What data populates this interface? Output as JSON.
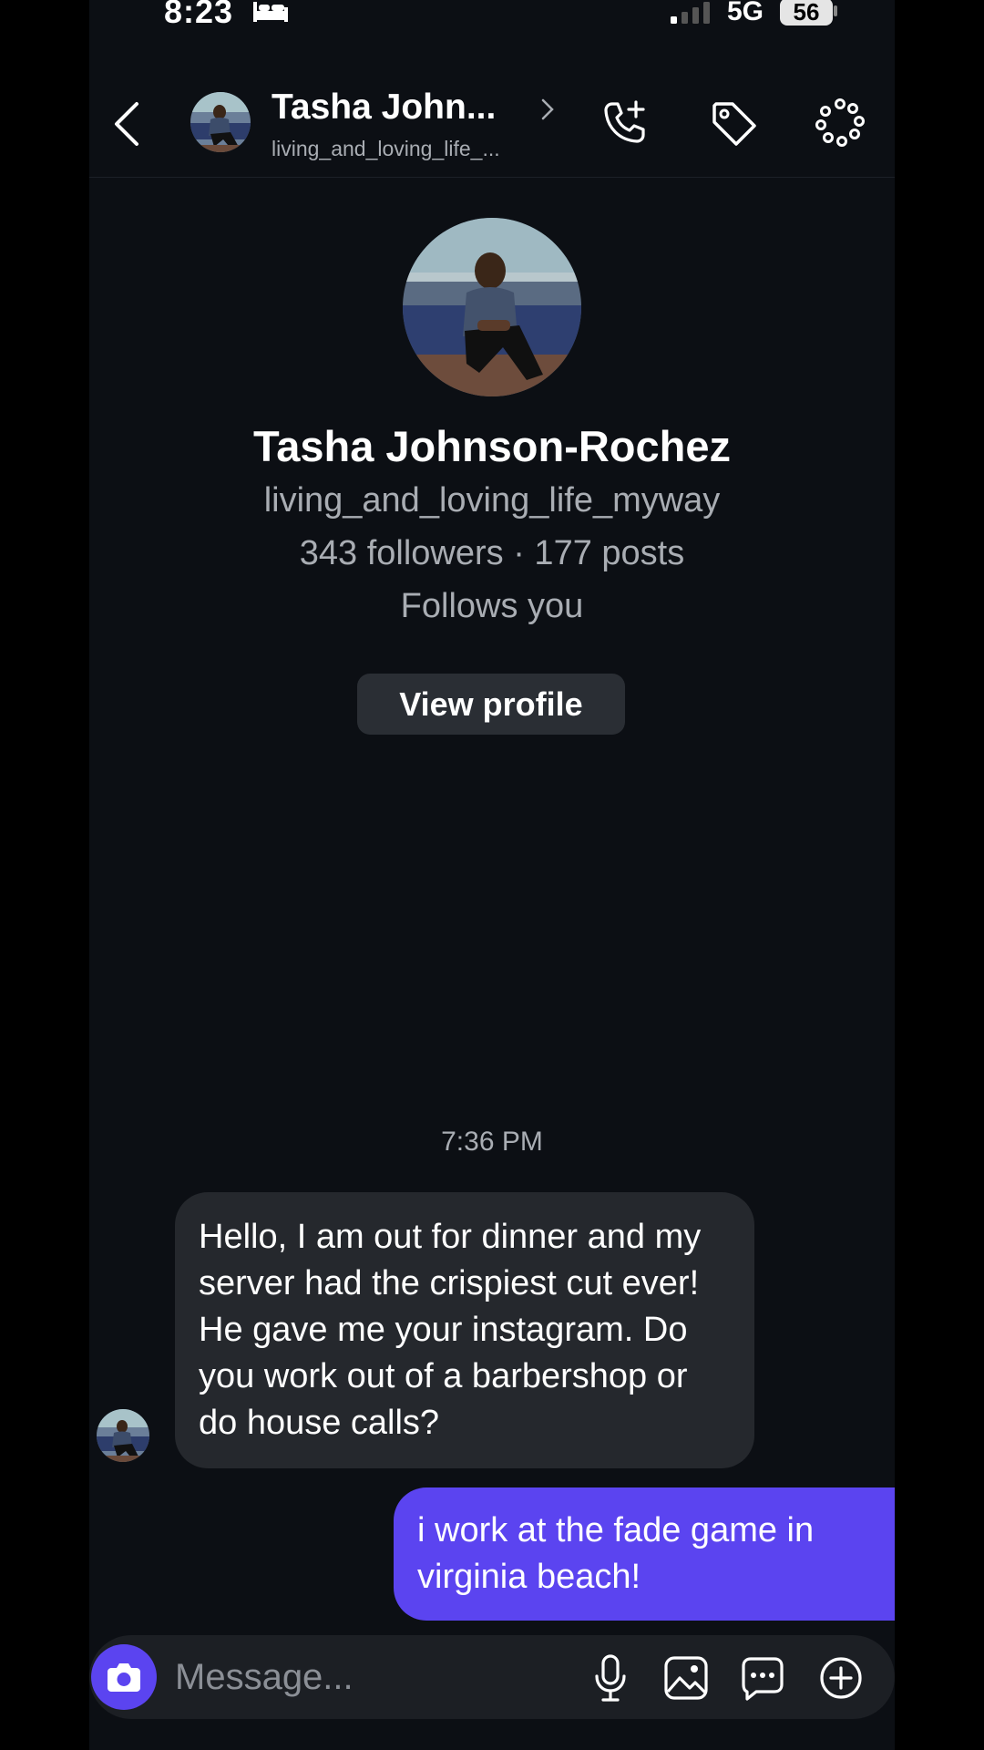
{
  "status_bar": {
    "time": "8:23",
    "network": "5G",
    "battery": "56",
    "icons": [
      "bed-icon",
      "signal-icon"
    ]
  },
  "header": {
    "name": "Tasha John...",
    "username": "living_and_loving_life_...",
    "icons": [
      "back-arrow-icon",
      "add-call-icon",
      "tag-icon",
      "dots-circle-icon",
      "chevron-right-icon"
    ]
  },
  "profile": {
    "name": "Tasha Johnson-Rochez",
    "username": "living_and_loving_life_myway",
    "stats": "343 followers · 177 posts",
    "follows_status": "Follows you",
    "view_profile_label": "View profile"
  },
  "conversation": {
    "timestamp": "7:36 PM",
    "messages": [
      {
        "direction": "incoming",
        "text": "Hello, I am out for dinner and my server had the crispiest cut ever! He gave me your instagram. Do you work out of a barbershop or do house calls?"
      },
      {
        "direction": "outgoing",
        "text": "i work at the fade game in virginia beach!"
      }
    ]
  },
  "composer": {
    "placeholder": "Message...",
    "icons": [
      "camera-icon",
      "microphone-icon",
      "gallery-icon",
      "sticker-icon",
      "add-circle-icon"
    ]
  },
  "colors": {
    "background": "#0c0f14",
    "accent": "#5b44f0",
    "incoming_bubble": "#25282d",
    "secondary_text": "#a9adb3"
  }
}
